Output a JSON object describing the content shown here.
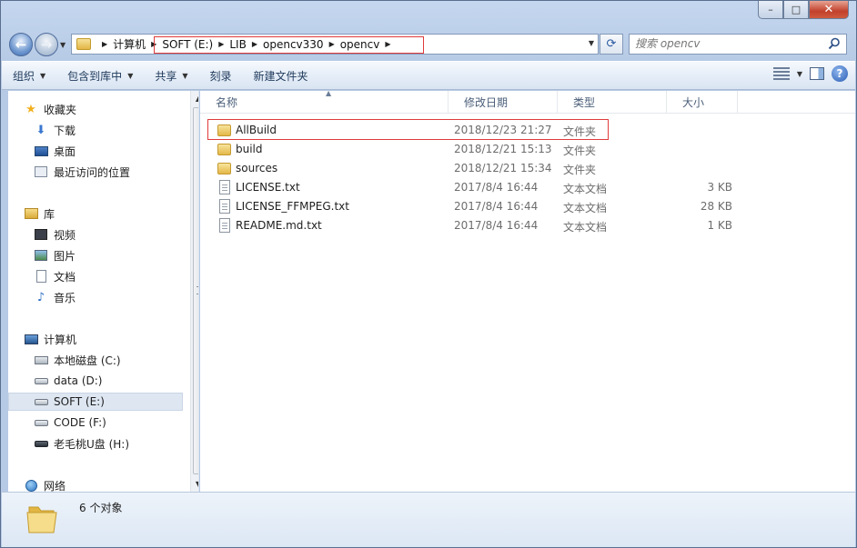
{
  "window": {
    "caption": {
      "minimize": "–",
      "maximize": "□",
      "close": "✕"
    }
  },
  "address": {
    "crumbs": [
      "计算机",
      "SOFT (E:)",
      "LIB",
      "opencv330",
      "opencv"
    ],
    "search_placeholder": "搜索 opencv"
  },
  "toolbar": {
    "organize": "组织",
    "include_in_library": "包含到库中",
    "share": "共享",
    "burn": "刻录",
    "new_folder": "新建文件夹"
  },
  "nav": {
    "favorites": "收藏夹",
    "downloads": "下载",
    "desktop": "桌面",
    "recent": "最近访问的位置",
    "libraries": "库",
    "videos": "视频",
    "pictures": "图片",
    "documents": "文档",
    "music": "音乐",
    "computer": "计算机",
    "drive_c": "本地磁盘 (C:)",
    "drive_d": "data (D:)",
    "drive_e": "SOFT (E:)",
    "drive_f": "CODE (F:)",
    "drive_h": "老毛桃U盘 (H:)",
    "network": "网络"
  },
  "columns": {
    "name": "名称",
    "date": "修改日期",
    "type": "类型",
    "size": "大小"
  },
  "files": [
    {
      "name": "AllBuild",
      "date": "2018/12/23 21:27",
      "type": "文件夹",
      "size": "",
      "kind": "folder"
    },
    {
      "name": "build",
      "date": "2018/12/21 15:13",
      "type": "文件夹",
      "size": "",
      "kind": "folder"
    },
    {
      "name": "sources",
      "date": "2018/12/21 15:34",
      "type": "文件夹",
      "size": "",
      "kind": "folder"
    },
    {
      "name": "LICENSE.txt",
      "date": "2017/8/4 16:44",
      "type": "文本文档",
      "size": "3 KB",
      "kind": "file"
    },
    {
      "name": "LICENSE_FFMPEG.txt",
      "date": "2017/8/4 16:44",
      "type": "文本文档",
      "size": "28 KB",
      "kind": "file"
    },
    {
      "name": "README.md.txt",
      "date": "2017/8/4 16:44",
      "type": "文本文档",
      "size": "1 KB",
      "kind": "file"
    }
  ],
  "status": {
    "count": "6 个对象"
  }
}
